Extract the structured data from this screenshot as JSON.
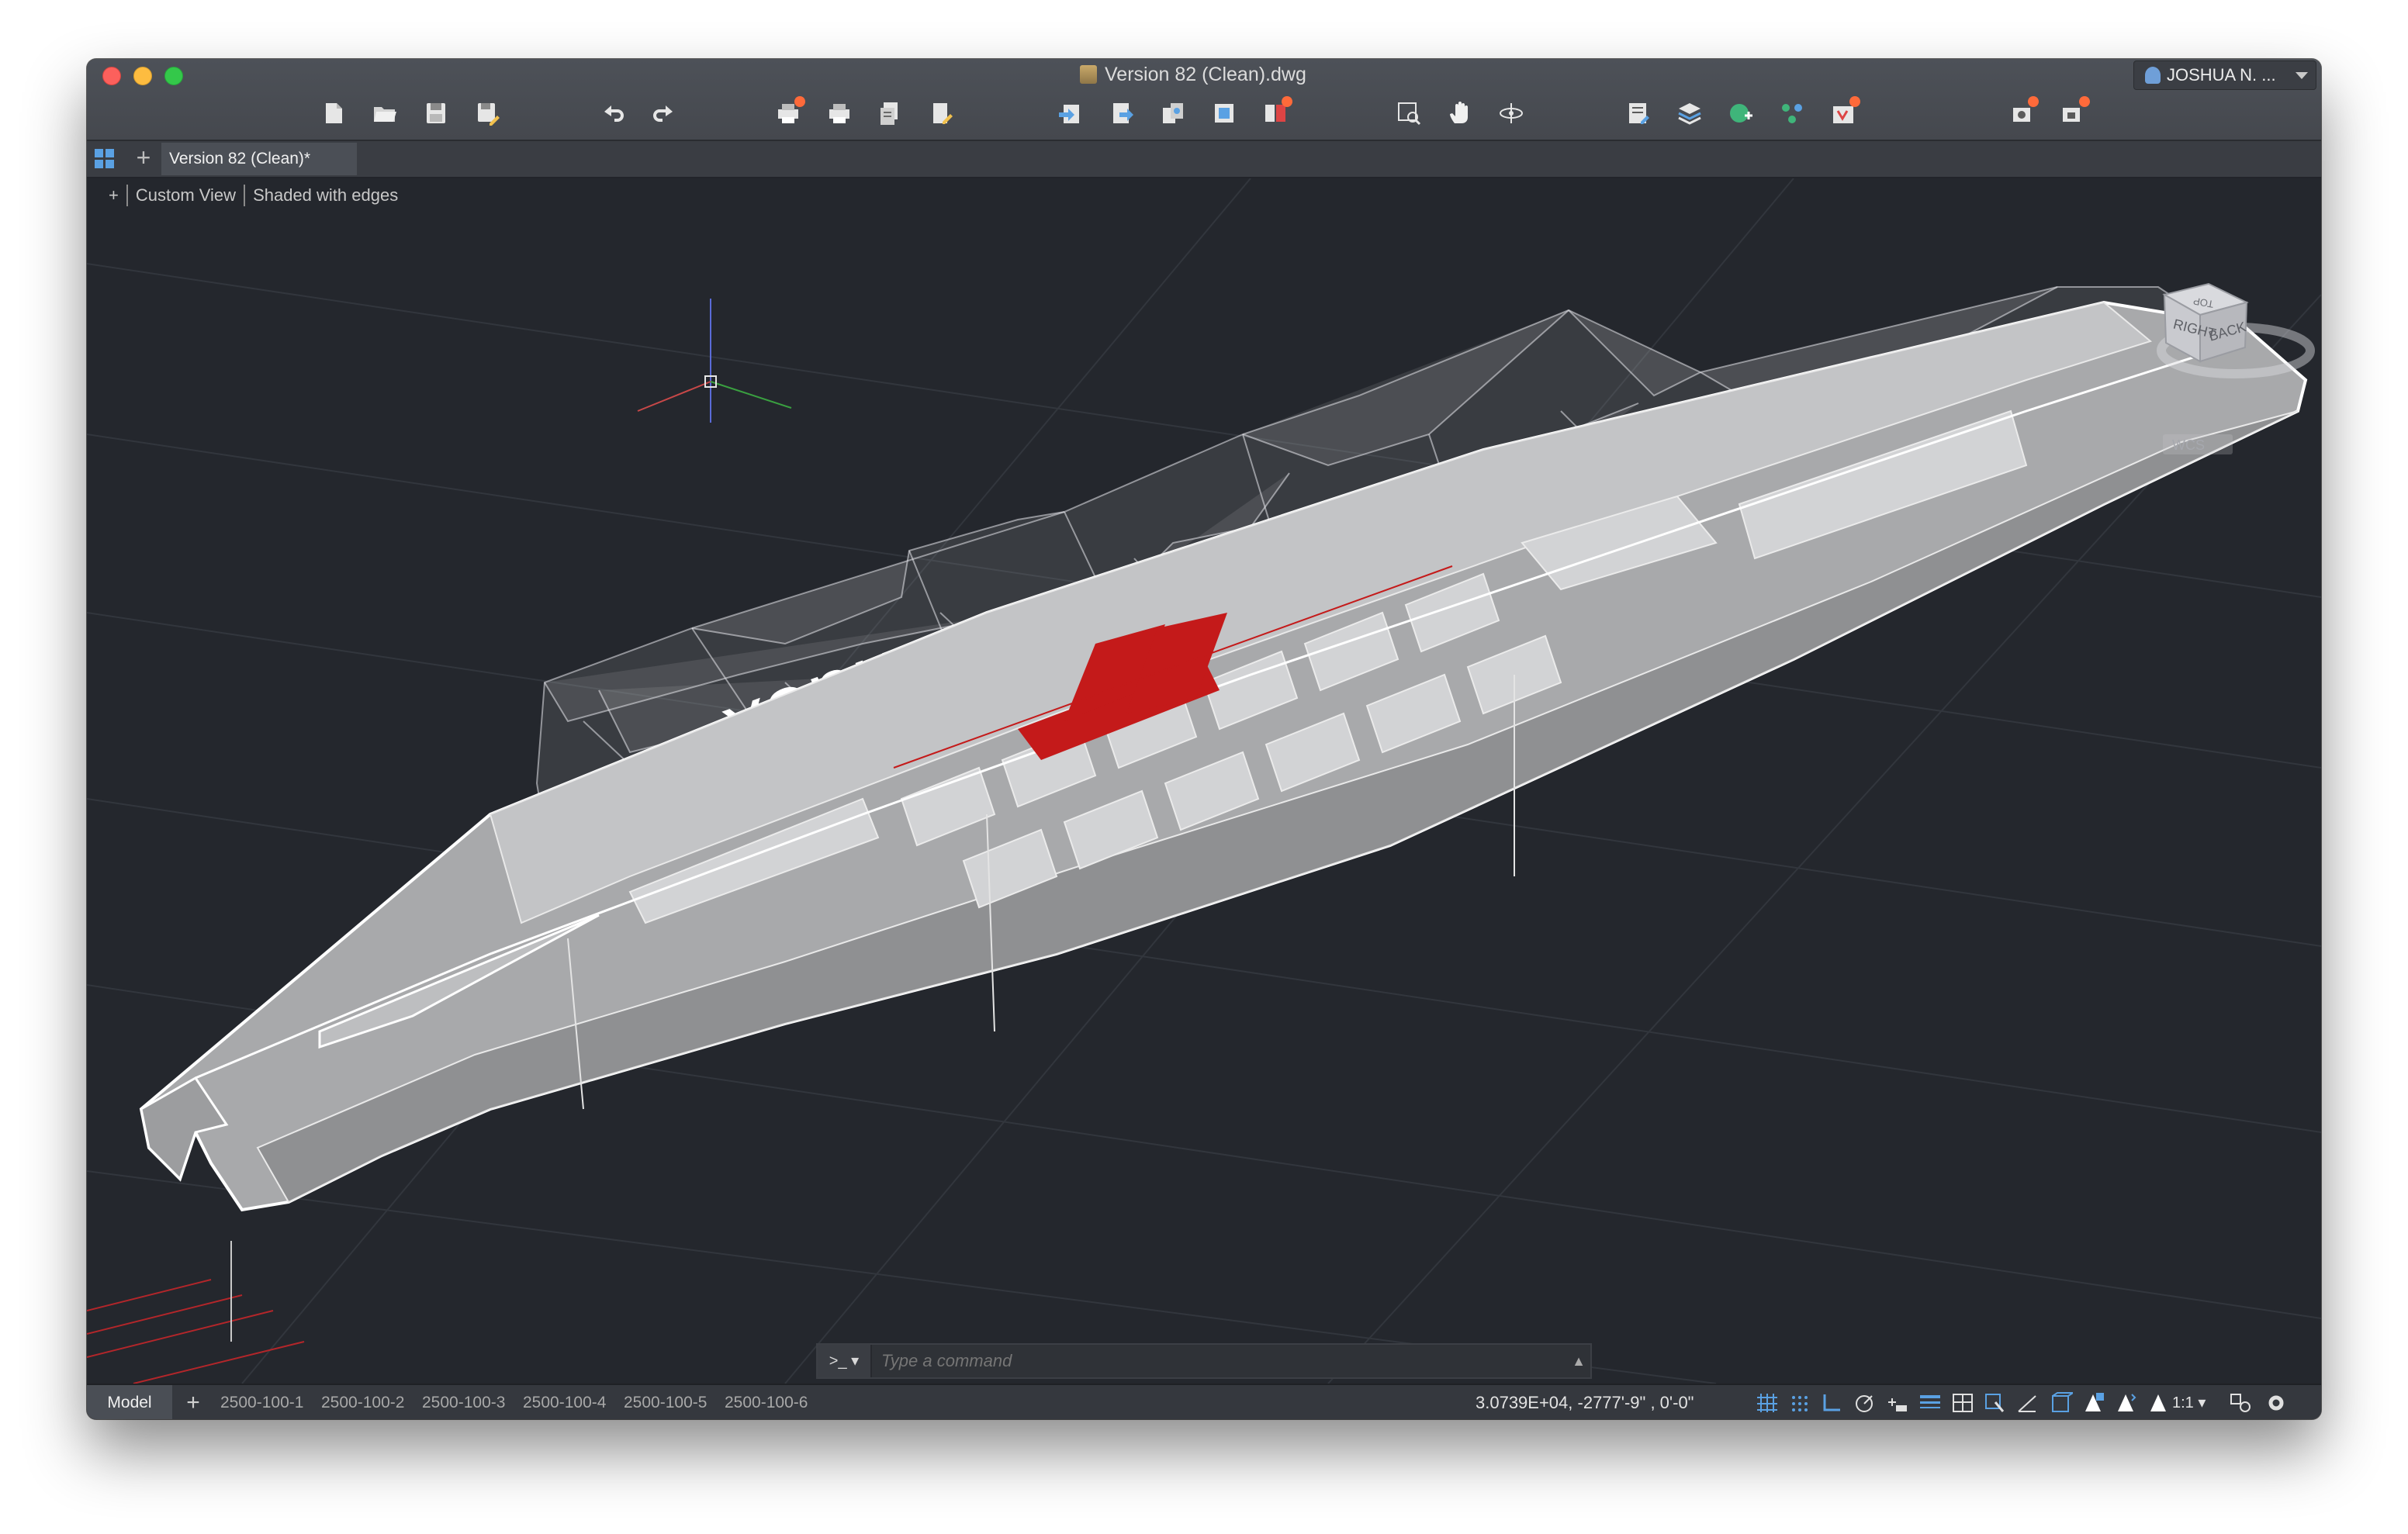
{
  "window": {
    "title": "Version 82 (Clean).dwg",
    "user_name": "JOSHUA N. ..."
  },
  "toolbar": {
    "items": [
      "new-icon",
      "open-icon",
      "save-icon",
      "save-as-icon",
      "undo-icon",
      "redo-icon",
      "plot-icon",
      "print-icon",
      "batch-plot-icon",
      "publish-icon",
      "import-icon",
      "export-icon",
      "xref-icon",
      "insert-icon",
      "attach-icon",
      "zoom-window-icon",
      "pan-icon",
      "orbit-icon",
      "properties-icon",
      "layers-icon",
      "render-icon",
      "constraints-icon",
      "measure-icon",
      "sheet-icon",
      "camera-icon"
    ]
  },
  "tabs": {
    "new_tab": "+",
    "document": "Version 82 (Clean)*"
  },
  "viewport": {
    "plus": "+",
    "view_name": "Custom View",
    "visual_style": "Shaded with edges",
    "viewcube_right": "RIGHT",
    "viewcube_back": "BACK",
    "viewcube_top": "TOP",
    "ucs_label": "WCS",
    "mirror_text": "Zindex"
  },
  "command": {
    "prompt": ">_ ▾",
    "placeholder": "Type a command",
    "up_arrow": "▲"
  },
  "status": {
    "model_tab": "Model",
    "add_layout": "+",
    "layouts": [
      "2500-100-1",
      "2500-100-2",
      "2500-100-3",
      "2500-100-4",
      "2500-100-5",
      "2500-100-6"
    ],
    "coordinates": "3.0739E+04,   -2777'-9\"  , 0'-0\"",
    "scale": "1:1 ▾"
  },
  "colors": {
    "accent": "#5aa1e3",
    "badge": "#ff6a3a",
    "highlight": "#c41a1a"
  }
}
